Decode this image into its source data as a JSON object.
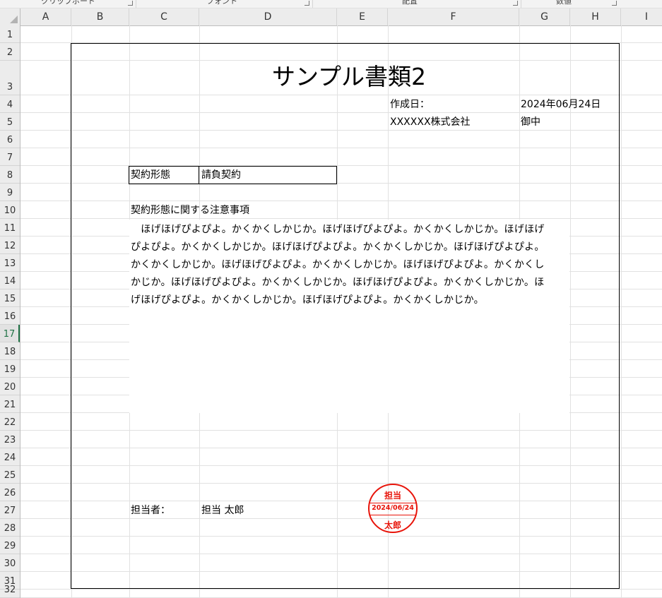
{
  "ribbon": {
    "groups": [
      "クリップボード",
      "フォント",
      "配置",
      "数値"
    ]
  },
  "columns": [
    "A",
    "B",
    "C",
    "D",
    "E",
    "F",
    "G",
    "H",
    "I"
  ],
  "rows": [
    "1",
    "2",
    "3",
    "4",
    "5",
    "6",
    "7",
    "8",
    "9",
    "10",
    "11",
    "12",
    "13",
    "14",
    "15",
    "16",
    "17",
    "18",
    "19",
    "20",
    "21",
    "22",
    "23",
    "24",
    "25",
    "26",
    "27",
    "28",
    "29",
    "30",
    "31",
    "32"
  ],
  "selected_row": "17",
  "document": {
    "title": "サンプル書類2",
    "created_label": "作成日：",
    "created_date": "2024年06月24日",
    "recipient": "XXXXXX株式会社",
    "honorific": "御中",
    "contract_label": "契約形態",
    "contract_value": "請負契約",
    "note_heading": "契約形態に関する注意事項",
    "note_lines": [
      "　ほげほげぴよぴよ。かくかくしかじか。ほげほげぴよぴよ。かくかくしかじか。ほげほげ",
      "ぴよぴよ。かくかくしかじか。ほげほげぴよぴよ。かくかくしかじか。ほげほげぴよぴよ。",
      "かくかくしかじか。ほげほげぴよぴよ。かくかくしかじか。ほげほげぴよぴよ。かくかくし",
      "かじか。ほげほげぴよぴよ。かくかくしかじか。ほげほげぴよぴよ。かくかくしかじか。ほ",
      "げほげぴよぴよ。かくかくしかじか。ほげほげぴよぴよ。かくかくしかじか。"
    ],
    "person_label": "担当者：",
    "person_name": "担当 太郎"
  },
  "stamp": {
    "top": "担当",
    "date": "2024/06/24",
    "bottom": "太郎",
    "color": "#e8140a"
  }
}
